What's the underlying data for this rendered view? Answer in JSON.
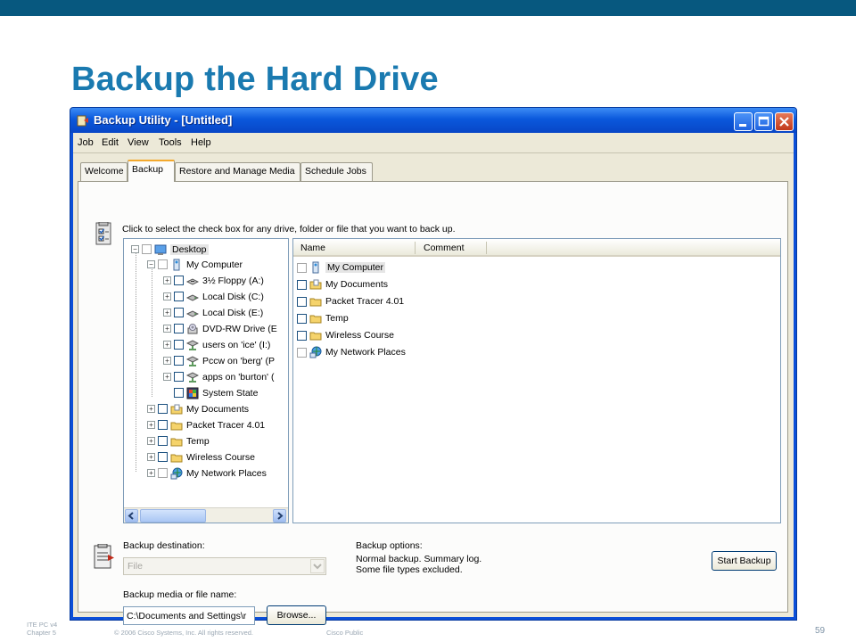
{
  "slide": {
    "title": "Backup the Hard Drive",
    "footer": {
      "course": "ITE PC v4",
      "chapter": "Chapter 5",
      "copyright": "© 2006 Cisco Systems, Inc. All rights reserved.",
      "classification": "Cisco Public",
      "page": "59"
    },
    "colors": {
      "topbar": "#07587f",
      "title": "#1a7ab0"
    }
  },
  "window": {
    "title": "Backup Utility - [Untitled]",
    "menu": [
      "Job",
      "Edit",
      "View",
      "Tools",
      "Help"
    ],
    "tabs": [
      "Welcome",
      "Backup",
      "Restore and Manage Media",
      "Schedule Jobs"
    ],
    "active_tab": "Backup",
    "instruction": "Click to select the check box for any drive, folder or file that you want to back up.",
    "tree": [
      {
        "label": "Desktop",
        "icon": "desktop-icon"
      },
      {
        "label": "My Computer",
        "icon": "computer-icon"
      },
      {
        "label": "3½ Floppy (A:)",
        "icon": "floppy-drive-icon"
      },
      {
        "label": "Local Disk (C:)",
        "icon": "hard-disk-icon"
      },
      {
        "label": "Local Disk (E:)",
        "icon": "hard-disk-icon"
      },
      {
        "label": "DVD-RW Drive (E",
        "icon": "dvd-drive-icon"
      },
      {
        "label": "users on 'ice' (I:)",
        "icon": "network-drive-icon"
      },
      {
        "label": "Pccw on 'berg' (P",
        "icon": "network-drive-icon"
      },
      {
        "label": "apps on 'burton' (",
        "icon": "network-drive-icon"
      },
      {
        "label": "System State",
        "icon": "system-state-icon"
      },
      {
        "label": "My Documents",
        "icon": "documents-folder-icon"
      },
      {
        "label": "Packet Tracer 4.01",
        "icon": "folder-icon"
      },
      {
        "label": "Temp",
        "icon": "folder-icon"
      },
      {
        "label": "Wireless Course",
        "icon": "folder-icon"
      },
      {
        "label": "My Network Places",
        "icon": "network-places-icon"
      }
    ],
    "list": {
      "columns": [
        "Name",
        "Comment"
      ],
      "rows": [
        {
          "name": "My Computer",
          "icon": "computer-icon"
        },
        {
          "name": "My Documents",
          "icon": "documents-folder-icon"
        },
        {
          "name": "Packet Tracer 4.01",
          "icon": "folder-icon"
        },
        {
          "name": "Temp",
          "icon": "folder-icon"
        },
        {
          "name": "Wireless Course",
          "icon": "folder-icon"
        },
        {
          "name": "My Network Places",
          "icon": "network-places-icon"
        }
      ]
    },
    "backup_destination": {
      "label": "Backup destination:",
      "value": "File"
    },
    "backup_media": {
      "label": "Backup media or file name:",
      "value": "C:\\Documents and Settings\\r"
    },
    "browse_button": "Browse...",
    "backup_options": {
      "label": "Backup options:",
      "lines": [
        "Normal backup.  Summary log.",
        "Some file types excluded."
      ]
    },
    "start_button": "Start Backup"
  }
}
